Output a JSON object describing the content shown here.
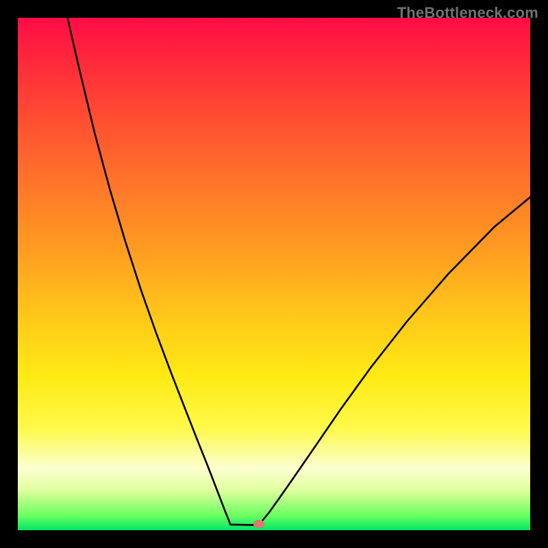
{
  "watermark": "TheBottleneck.com",
  "chart_data": {
    "type": "line",
    "title": "",
    "xlabel": "",
    "ylabel": "",
    "xlim": [
      0,
      100
    ],
    "ylim": [
      0,
      100
    ],
    "grid": false,
    "legend": false,
    "series": [
      {
        "name": "left-branch",
        "x": [
          9.7,
          12,
          15,
          18,
          21,
          24,
          27,
          30,
          33,
          35,
          37,
          39,
          40.5,
          41.5
        ],
        "y": [
          100,
          90,
          77.5,
          66.4,
          56.3,
          47.0,
          38.5,
          30.5,
          22.8,
          17.7,
          12.7,
          7.5,
          3.6,
          1.1
        ]
      },
      {
        "name": "flat-bottom",
        "x": [
          41.5,
          47.0
        ],
        "y": [
          1.1,
          1.0
        ]
      },
      {
        "name": "right-branch",
        "x": [
          47.0,
          49,
          51,
          54,
          58,
          63,
          69,
          76,
          84,
          93,
          100
        ],
        "y": [
          1.0,
          3.4,
          6.2,
          10.5,
          16.3,
          23.6,
          31.9,
          40.8,
          50.0,
          59.2,
          65.0
        ]
      }
    ],
    "marker": {
      "x": 47.0,
      "y": 1.2
    },
    "background_gradient_stops": [
      {
        "pct": 0,
        "color": "#ff0c45"
      },
      {
        "pct": 10,
        "color": "#ff2e3a"
      },
      {
        "pct": 22,
        "color": "#ff5530"
      },
      {
        "pct": 34,
        "color": "#ff7a29"
      },
      {
        "pct": 46,
        "color": "#ff9e21"
      },
      {
        "pct": 58,
        "color": "#ffc71a"
      },
      {
        "pct": 70,
        "color": "#ffea14"
      },
      {
        "pct": 80,
        "color": "#fff94a"
      },
      {
        "pct": 88,
        "color": "#fcffd0"
      },
      {
        "pct": 92,
        "color": "#e3ffa0"
      },
      {
        "pct": 97,
        "color": "#6fff63"
      },
      {
        "pct": 100,
        "color": "#00e863"
      }
    ]
  }
}
